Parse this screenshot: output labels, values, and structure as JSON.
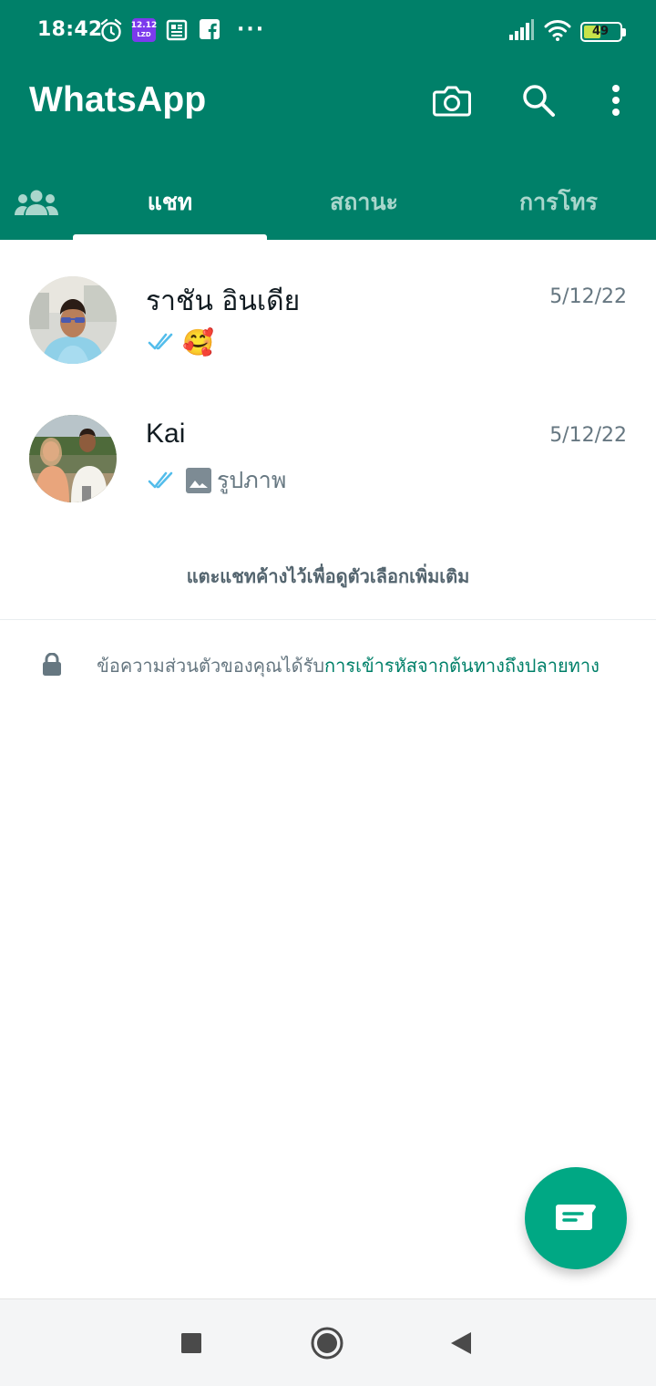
{
  "status_bar": {
    "time": "18:42",
    "calendar_badge": [
      "12.12",
      "LZD"
    ],
    "more": "···",
    "battery_level": "49",
    "icons": [
      "alarm-icon",
      "calendar-app-icon",
      "news-icon",
      "facebook-icon",
      "signal-icon",
      "wifi-icon",
      "battery-icon"
    ]
  },
  "header": {
    "title": "WhatsApp",
    "actions": [
      "camera-icon",
      "search-icon",
      "more-vert-icon"
    ],
    "colors": {
      "primary": "#008069",
      "tab_inactive": "#a9d6cc"
    }
  },
  "tabs": {
    "community_icon": "community-icon",
    "items": [
      {
        "label": "แชท",
        "active": true
      },
      {
        "label": "สถานะ",
        "active": false
      },
      {
        "label": "การโทร",
        "active": false
      }
    ]
  },
  "chats": [
    {
      "name": "ราชัน อินเดีย",
      "date": "5/12/22",
      "preview_emoji": "🥰",
      "read_status": "double-check-icon",
      "tick_color": "#53bdeb"
    },
    {
      "name": "Kai",
      "date": "5/12/22",
      "preview_text": "รูปภาพ",
      "preview_icon": "image-icon",
      "read_status": "double-check-icon",
      "tick_color": "#53bdeb"
    }
  ],
  "hint": "แตะแชทค้างไว้เพื่อดูตัวเลือกเพิ่มเติม",
  "encryption": {
    "prefix": "ข้อความส่วนตัวของคุณได้รับ",
    "link": "การเข้ารหัสจากต้นทางถึงปลายทาง",
    "link_color": "#008069"
  },
  "fab": {
    "icon": "new-chat-icon",
    "color": "#00a884"
  },
  "nav": {
    "icons": [
      "recents-square-icon",
      "home-circle-icon",
      "back-triangle-icon"
    ]
  }
}
